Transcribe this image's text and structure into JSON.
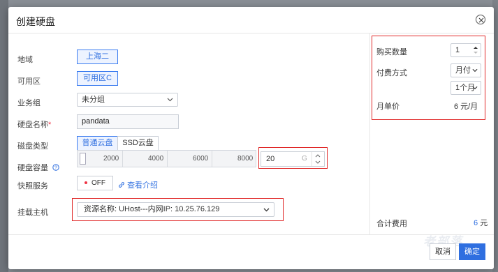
{
  "dialog": {
    "title": "创建硬盘"
  },
  "form": {
    "region_label": "地域",
    "region_value": "上海二",
    "zone_label": "可用区",
    "zone_value": "可用区C",
    "group_label": "业务组",
    "group_value": "未分组",
    "name_label": "硬盘名称",
    "name_required": "*",
    "name_value": "pandata",
    "type_label": "磁盘类型",
    "type_options": [
      "普通云盘",
      "SSD云盘"
    ],
    "type_selected": "普通云盘",
    "capacity_label": "硬盘容量",
    "capacity_ticks": [
      "2000",
      "4000",
      "6000",
      "8000"
    ],
    "capacity_value": "20",
    "capacity_unit": "G",
    "snapshot_label": "快照服务",
    "snapshot_state": "OFF",
    "snapshot_link": "查看介绍",
    "mount_label": "挂载主机",
    "mount_value": "资源名称: UHost---内网IP: 10.25.76.129"
  },
  "summary": {
    "qty_label": "购买数量",
    "qty_value": "1",
    "pay_label": "付费方式",
    "pay_value": "月付",
    "duration_value": "1个月",
    "price_label": "月单价",
    "price_value": "6 元/月",
    "total_label": "合计费用",
    "total_value": "6",
    "total_unit": "元"
  },
  "footer": {
    "cancel_label": "取消",
    "confirm_label": "确定"
  },
  "watermark": "老部落",
  "colors": {
    "accent": "#2f6fe0",
    "highlight": "#e02828"
  }
}
